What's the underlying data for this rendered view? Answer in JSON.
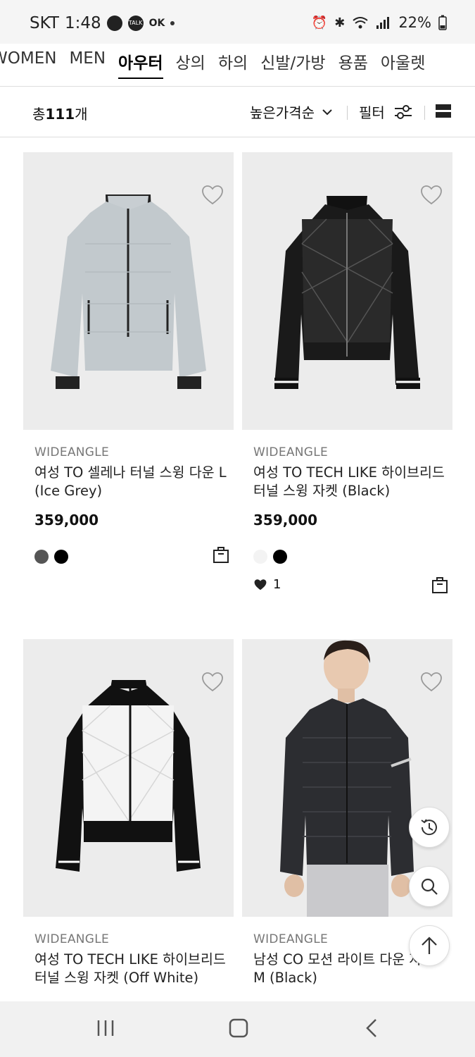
{
  "status_bar": {
    "carrier": "SKT",
    "time": "1:48",
    "talk_label": "TALK",
    "ok_label": "OK",
    "battery": "22%"
  },
  "category_nav": {
    "items": [
      "WOMEN",
      "MEN",
      "아우터",
      "상의",
      "하의",
      "신발/가방",
      "용품",
      "아울렛"
    ],
    "active_index": 2
  },
  "toolbar": {
    "count_prefix": "총",
    "count_value": "111",
    "count_suffix": "개",
    "sort_label": "높은가격순",
    "filter_label": "필터"
  },
  "products": [
    {
      "brand": "WIDEANGLE",
      "name": "여성 TO 셀레나 터널 스윙 다운 L (Ice Grey)",
      "price": "359,000",
      "swatches": [
        "#555555",
        "#000000"
      ],
      "likes": null
    },
    {
      "brand": "WIDEANGLE",
      "name": "여성 TO TECH LIKE 하이브리드 터널 스윙 자켓 (Black)",
      "price": "359,000",
      "swatches": [
        "#f3f3f3",
        "#000000"
      ],
      "likes": "1"
    },
    {
      "brand": "WIDEANGLE",
      "name": "여성 TO TECH LIKE 하이브리드 터널 스윙 자켓 (Off White)",
      "price": "",
      "swatches": [],
      "likes": null
    },
    {
      "brand": "WIDEANGLE",
      "name": "남성 CO 모션 라이트 다운 자켓 M (Black)",
      "price": "",
      "swatches": [],
      "likes": null
    }
  ],
  "colors": {
    "card_bg": "#ececec",
    "text": "#222222",
    "muted": "#777777"
  }
}
